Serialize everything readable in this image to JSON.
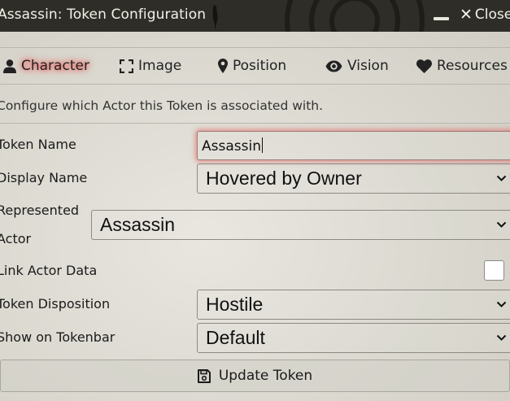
{
  "window": {
    "title": "Assassin: Token Configuration",
    "close_label": "Close"
  },
  "tabs": [
    {
      "label": "Character",
      "icon": "user-icon",
      "active": true
    },
    {
      "label": "Image",
      "icon": "expand-icon",
      "active": false
    },
    {
      "label": "Position",
      "icon": "map-marker-icon",
      "active": false
    },
    {
      "label": "Vision",
      "icon": "eye-icon",
      "active": false
    },
    {
      "label": "Resources",
      "icon": "heart-icon",
      "active": false
    }
  ],
  "description": "Configure which Actor this Token is associated with.",
  "fields": {
    "token_name": {
      "label": "Token Name",
      "value": "Assassin"
    },
    "display_name": {
      "label": "Display Name",
      "value": "Hovered by Owner"
    },
    "represented_actor": {
      "label_line1": "Represented",
      "label_line2": "Actor",
      "value": "Assassin"
    },
    "link_actor_data": {
      "label": "Link Actor Data",
      "checked": false
    },
    "token_disposition": {
      "label": "Token Disposition",
      "value": "Hostile"
    },
    "show_on_tokenbar": {
      "label": "Show on Tokenbar",
      "value": "Default"
    }
  },
  "submit": {
    "label": "Update Token",
    "icon": "save-icon"
  },
  "colors": {
    "header_bg": "#2f2d28",
    "active_tab_glow": "#e04040"
  }
}
